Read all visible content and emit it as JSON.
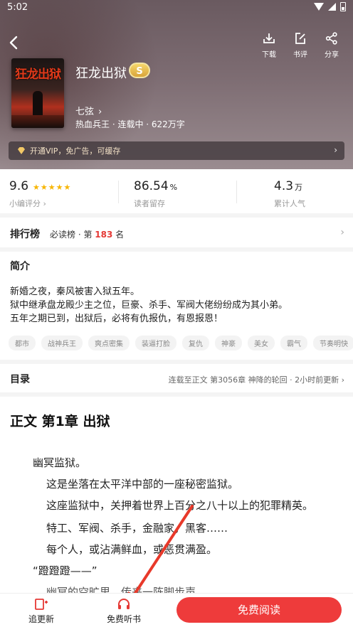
{
  "status_bar": {
    "time": "5:02"
  },
  "header": {
    "actions": [
      {
        "label": "下载",
        "icon": "download-icon"
      },
      {
        "label": "书评",
        "icon": "edit-icon"
      },
      {
        "label": "分享",
        "icon": "share-icon"
      }
    ]
  },
  "book": {
    "cover_title": "狂龙出狱",
    "title": "狂龙出狱",
    "badge": "S",
    "author": "七弦",
    "meta": "热血兵王 · 连载中 · 622万字"
  },
  "vip": {
    "text": "开通VIP，免广告，可缓存"
  },
  "stats": [
    {
      "value": "9.6",
      "unit": "",
      "label": "小编评分",
      "stars": 5
    },
    {
      "value": "86.54",
      "unit": "%",
      "label": "读者留存"
    },
    {
      "value": "4.3",
      "unit": "万",
      "label": "累计人气"
    }
  ],
  "ranking": {
    "title": "排行榜",
    "list": "必读榜 · 第",
    "rank": "183",
    "suffix": "名"
  },
  "intro": {
    "title": "简介",
    "lines": [
      "新婚之夜，秦风被害入狱五年。",
      "狱中继承盘龙殿少主之位，巨豪、杀手、军阀大佬纷纷成为其小弟。",
      "五年之期已到，出狱后，必将有仇报仇，有恩报恩！"
    ],
    "tags": [
      "都市",
      "战神兵王",
      "爽点密集",
      "装逼打脸",
      "复仇",
      "神豪",
      "美女",
      "霸气",
      "节奏明快"
    ]
  },
  "toc": {
    "title": "目录",
    "info": "连载至正文 第3056章 神降的轮回 · 2小时前更新 ›"
  },
  "chapter": {
    "title": "正文 第1章 出狱",
    "paragraphs": [
      "幽冥监狱。",
      "这是坐落在太平洋中部的一座秘密监狱。",
      "这座监狱中，关押着世界上百分之八十以上的犯罪精英。",
      "特工、军阀、杀手，金融家，黑客……",
      "每个人，或沾满鲜血，或恶贯满盈。",
      "“蹬蹬蹬——”",
      "幽冥的空旷里，传来一阵脚步声"
    ]
  },
  "bottom_bar": {
    "follow_label": "追更新",
    "listen_label": "免费听书",
    "read_label": "免费阅读"
  },
  "colors": {
    "accent": "#ee3b3b",
    "star": "#f7b500",
    "rank": "#e53935"
  }
}
